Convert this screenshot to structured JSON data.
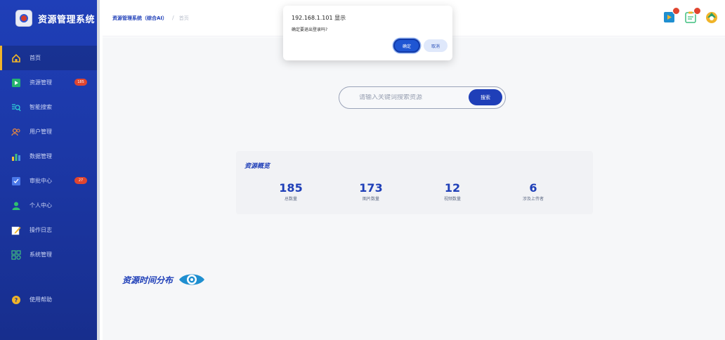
{
  "app": {
    "title": "资源管理系统"
  },
  "sidebar": {
    "items": [
      {
        "label": "首页",
        "icon": "home-icon",
        "active": true
      },
      {
        "label": "资源管理",
        "icon": "resource-icon",
        "badge": "185"
      },
      {
        "label": "智能搜索",
        "icon": "smart-search-icon"
      },
      {
        "label": "用户管理",
        "icon": "users-icon"
      },
      {
        "label": "数据管理",
        "icon": "bar-chart-icon"
      },
      {
        "label": "审批中心",
        "icon": "approval-icon",
        "badge": "27"
      },
      {
        "label": "个人中心",
        "icon": "person-icon"
      },
      {
        "label": "操作日志",
        "icon": "edit-log-icon"
      },
      {
        "label": "系统管理",
        "icon": "system-icon"
      },
      {
        "label": "使用帮助",
        "icon": "help-icon"
      }
    ]
  },
  "header": {
    "breadcrumb_root": "资源管理系统（综合AI）",
    "breadcrumb_sep": "/",
    "breadcrumb_current": "首页",
    "icons": [
      {
        "icon": "video-icon",
        "badge_color": "#e0452f"
      },
      {
        "icon": "clipboard-icon",
        "badge_color": "#e0452f"
      },
      {
        "icon": "avatar-icon"
      }
    ]
  },
  "search": {
    "placeholder": "请输入关键词搜索资源",
    "button_label": "搜索"
  },
  "overview": {
    "title": "资源概览",
    "stats": [
      {
        "value": "185",
        "label": "总数量"
      },
      {
        "value": "173",
        "label": "图片数量"
      },
      {
        "value": "12",
        "label": "视频数量"
      },
      {
        "value": "6",
        "label": "涉及上传者"
      }
    ]
  },
  "distribution": {
    "title": "资源时间分布"
  },
  "dialog": {
    "title": "192.168.1.101 显示",
    "message": "确定要退出登录吗?",
    "ok_label": "确定",
    "cancel_label": "取消"
  },
  "colors": {
    "primary": "#1f3fb8",
    "badge": "#e0452f",
    "accent": "#f0b429"
  }
}
